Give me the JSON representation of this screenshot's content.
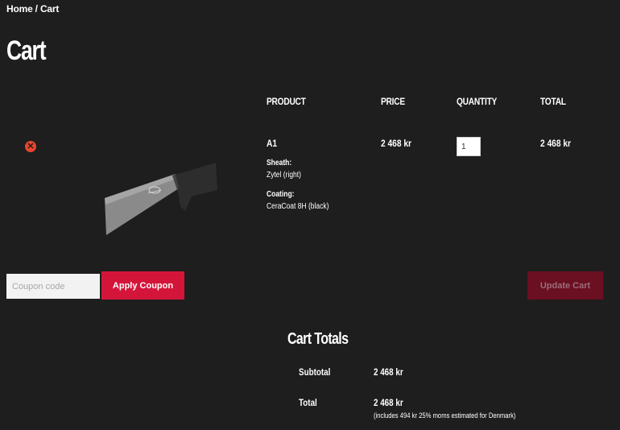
{
  "breadcrumb": {
    "home": "Home",
    "separator": " / ",
    "current": "Cart"
  },
  "page_title": "Cart",
  "table": {
    "headers": {
      "product": "PRODUCT",
      "price": "PRICE",
      "quantity": "QUANTITY",
      "total": "TOTAL"
    },
    "rows": [
      {
        "remove_icon": "times-circle-icon",
        "name": "A1",
        "meta": [
          {
            "key": "Sheath:",
            "value": "Zytel (right)"
          },
          {
            "key": "Coating:",
            "value": "CeraCoat 8H (black)"
          }
        ],
        "price": "2 468 kr",
        "quantity": "1",
        "total": "2 468 kr"
      }
    ]
  },
  "coupon": {
    "placeholder": "Coupon code",
    "apply_label": "Apply Coupon"
  },
  "update_label": "Update Cart",
  "totals": {
    "title": "Cart Totals",
    "subtotal_label": "Subtotal",
    "subtotal_value": "2 468 kr",
    "total_label": "Total",
    "total_value": "2 468 kr",
    "tax_note": "(includes 494 kr 25% moms estimated for Denmark)"
  },
  "colors": {
    "background": "#1e1e1e",
    "accent": "#d4153a",
    "accent_disabled": "#6b0f22",
    "remove": "#e8452c"
  }
}
